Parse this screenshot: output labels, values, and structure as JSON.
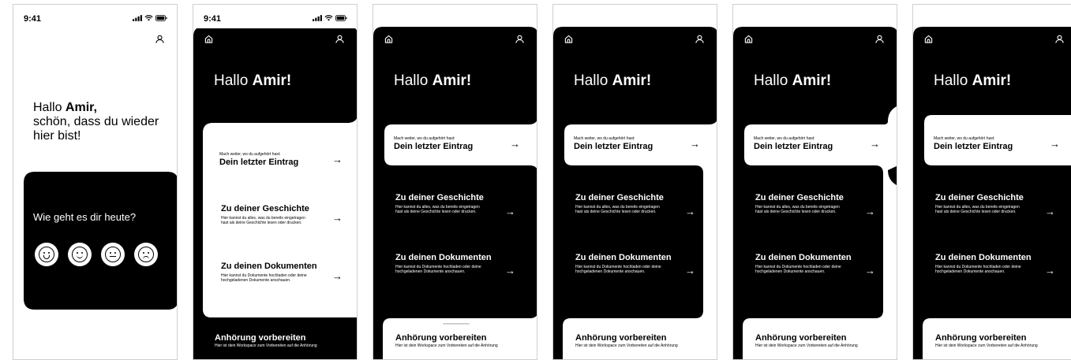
{
  "status": {
    "time": "9:41"
  },
  "screen1": {
    "greeting": "Hallo",
    "name": "Amir,",
    "line2": "schön, dass du wieder",
    "line3": "hier bist!",
    "mood_question": "Wie geht es dir heute?",
    "moods": [
      "very-happy-face-icon",
      "happy-face-icon",
      "neutral-face-icon",
      "sad-face-icon"
    ]
  },
  "greeting": {
    "prefix": "Hallo",
    "name": "Amir!"
  },
  "cards": {
    "last_entry_hint": "Mach weiter, wo du aufgehört hast:",
    "last_entry_title": "Dein letzter Eintrag",
    "story_title": "Zu deiner Geschichte",
    "story_desc1": "Hier kannst du alles, was du bereits eingetragen",
    "story_desc2": "hast als deine Geschichte lesen oder drucken.",
    "docs_title": "Zu deinen Dokumenten",
    "docs_desc1": "Hier kannst du Dokumente hochladen oder deine",
    "docs_desc2": "hochgeladenen Dokumente anschauen.",
    "hearing_title": "Anhörung vorbereiten",
    "hearing_desc": "Hier ist dein Workspace zum Vorbereiten auf die Anhörung",
    "arrow": "→"
  },
  "colors": {
    "primary": "#000000",
    "background": "#ffffff"
  }
}
